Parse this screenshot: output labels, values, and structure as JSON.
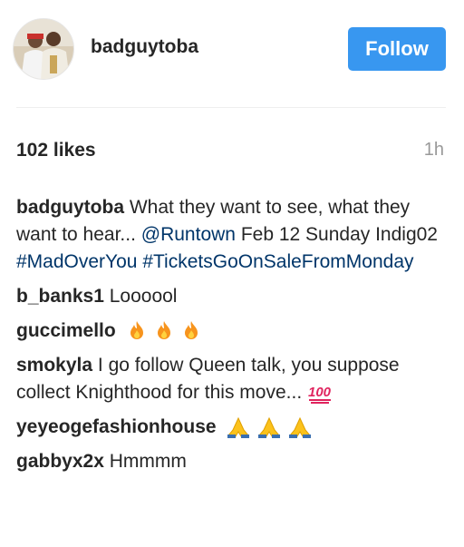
{
  "post": {
    "author": "badguytoba",
    "follow_label": "Follow",
    "likes": "102 likes",
    "time": "1h"
  },
  "caption": {
    "user": "badguytoba",
    "text_1": "What they want to see, what they want to hear...",
    "mention": "@Runtown",
    "text_2": "Feb 12 Sunday Indig02",
    "hashtag_1": "#MadOverYou",
    "hashtag_2": "#TicketsGoOnSaleFromMonday"
  },
  "comments": [
    {
      "user": "b_banks1",
      "text": "Loooool"
    },
    {
      "user": "guccimello",
      "text": "",
      "emoji": "fire-icon"
    },
    {
      "user": "smokyla",
      "text": "I go follow Queen talk, you suppose collect Knighthood for this move...",
      "emoji": "hundred-points-icon"
    },
    {
      "user": "yeyeogefashionhouse",
      "text": "",
      "emoji": "praying-hands-icon"
    },
    {
      "user": "gabbyx2x",
      "text": "Hmmmm"
    }
  ],
  "colors": {
    "follow_button": "#3897f0",
    "link": "#003569",
    "muted": "#999999"
  }
}
